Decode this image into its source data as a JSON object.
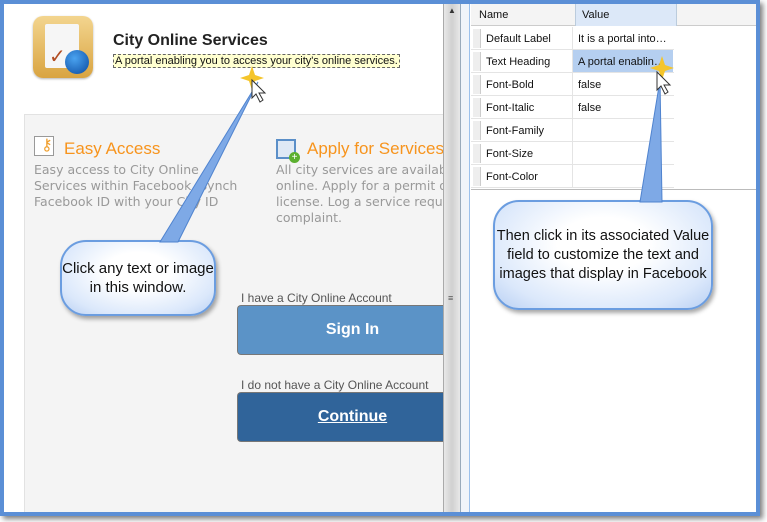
{
  "app": {
    "title": "City Online Services",
    "subtitle": "A portal enabling you to access your city's online services."
  },
  "features": [
    {
      "icon": "key-notepad-icon",
      "heading": "Easy Access",
      "lines": [
        "Easy access to City Online",
        "Services within Facebook. Synch",
        "Facebook ID with your City ID"
      ]
    },
    {
      "icon": "apply-form-icon",
      "heading": "Apply for Services",
      "lines": [
        "All city services are available",
        "online. Apply for a permit or",
        "license. Log a service request or",
        "complaint."
      ]
    }
  ],
  "accounts": {
    "have_label": "I have a City Online Account",
    "signin": "Sign In",
    "not_have_label": "I do not have a City Online Account",
    "continue": "Continue"
  },
  "grid": {
    "headers": {
      "name": "Name",
      "value": "Value"
    },
    "rows": [
      {
        "name": "Default Label",
        "value": "It is a portal into…"
      },
      {
        "name": "Text Heading",
        "value": "A portal enablin…"
      },
      {
        "name": "Font-Bold",
        "value": "false"
      },
      {
        "name": "Font-Italic",
        "value": "false"
      },
      {
        "name": "Font-Family",
        "value": ""
      },
      {
        "name": "Font-Size",
        "value": ""
      },
      {
        "name": "Font-Color",
        "value": ""
      }
    ]
  },
  "callouts": {
    "left": "Click any text or image in this window.",
    "right": "Then click in its associated Value field to customize the text and images that display in Facebook"
  },
  "scrollbar": {
    "up": "▲",
    "grip": "≡"
  },
  "colors": {
    "accent": "#f7941d",
    "signin": "#5b93c7",
    "continue": "#30649a",
    "frame": "#5b8fd6"
  }
}
